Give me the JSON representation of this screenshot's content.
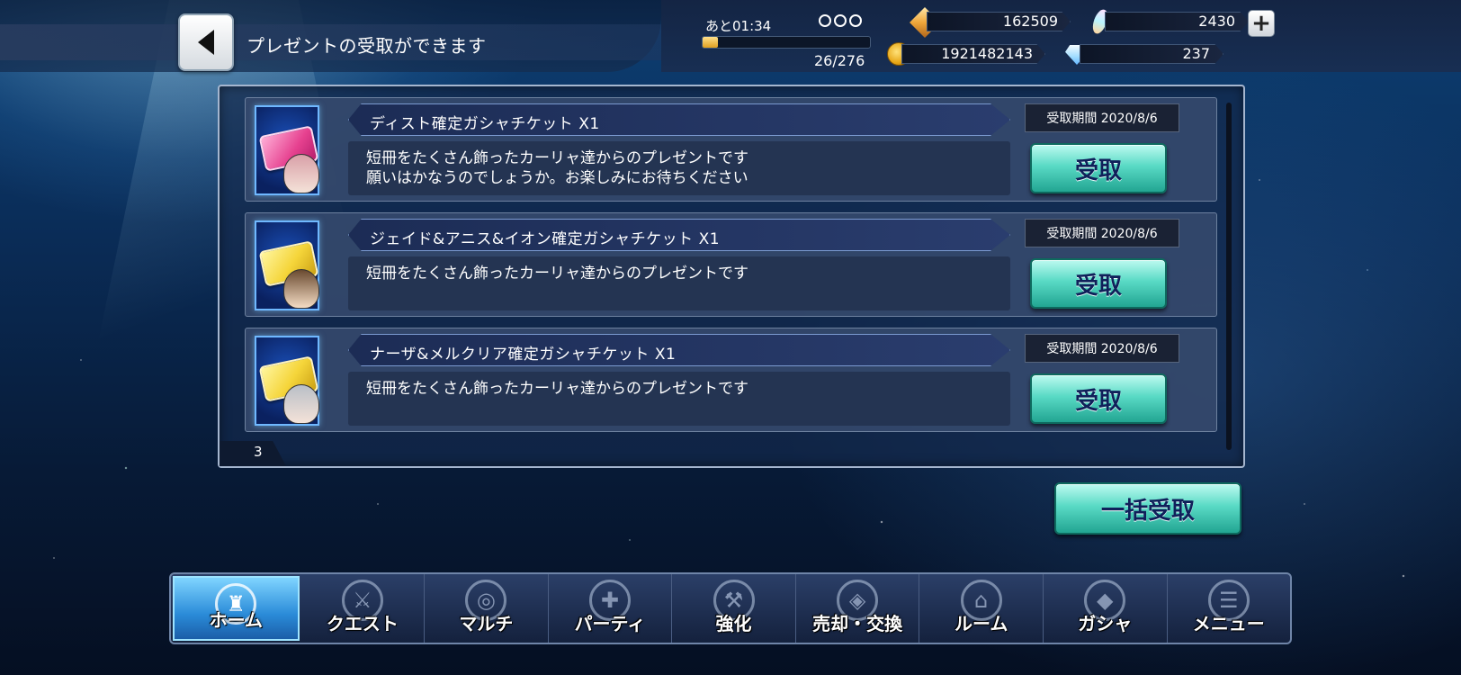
{
  "header": {
    "title": "プレゼントの受取ができます"
  },
  "status": {
    "timer": "あと01:34",
    "stamina": "26/276",
    "stamina_fraction": 0.094,
    "crystal": "162509",
    "gem": "2430",
    "gald": "1921482143",
    "diamond": "237"
  },
  "presents": [
    {
      "name": "ディスト確定ガシャチケット X1",
      "description": "短冊をたくさん飾ったカーリャ達からのプレゼントです\n願いはかなうのでしょうか。お楽しみにお待ちください",
      "deadline": "受取期間 2020/8/6",
      "receive_label": "受取",
      "ticket_color": "#e6418f"
    },
    {
      "name": "ジェイド&アニス&イオン確定ガシャチケット X1",
      "description": "短冊をたくさん飾ったカーリャ達からのプレゼントです",
      "deadline": "受取期間 2020/8/6",
      "receive_label": "受取",
      "ticket_color": "#f5d53a"
    },
    {
      "name": "ナーザ&メルクリア確定ガシャチケット X1",
      "description": "短冊をたくさん飾ったカーリャ達からのプレゼントです",
      "deadline": "受取期間 2020/8/6",
      "receive_label": "受取",
      "ticket_color": "#f5d53a"
    }
  ],
  "list_count": "3",
  "bulk_receive_label": "一括受取",
  "nav": [
    {
      "label": "ホーム",
      "icon": "tower-icon",
      "active": true
    },
    {
      "label": "クエスト",
      "icon": "quest-icon",
      "active": false
    },
    {
      "label": "マルチ",
      "icon": "multi-icon",
      "active": false
    },
    {
      "label": "パーティ",
      "icon": "party-icon",
      "active": false
    },
    {
      "label": "強化",
      "icon": "enhance-icon",
      "active": false
    },
    {
      "label": "売却・交換",
      "icon": "exchange-icon",
      "active": false
    },
    {
      "label": "ルーム",
      "icon": "room-icon",
      "active": false
    },
    {
      "label": "ガシャ",
      "icon": "gacha-icon",
      "active": false
    },
    {
      "label": "メニュー",
      "icon": "menu-icon",
      "active": false
    }
  ]
}
